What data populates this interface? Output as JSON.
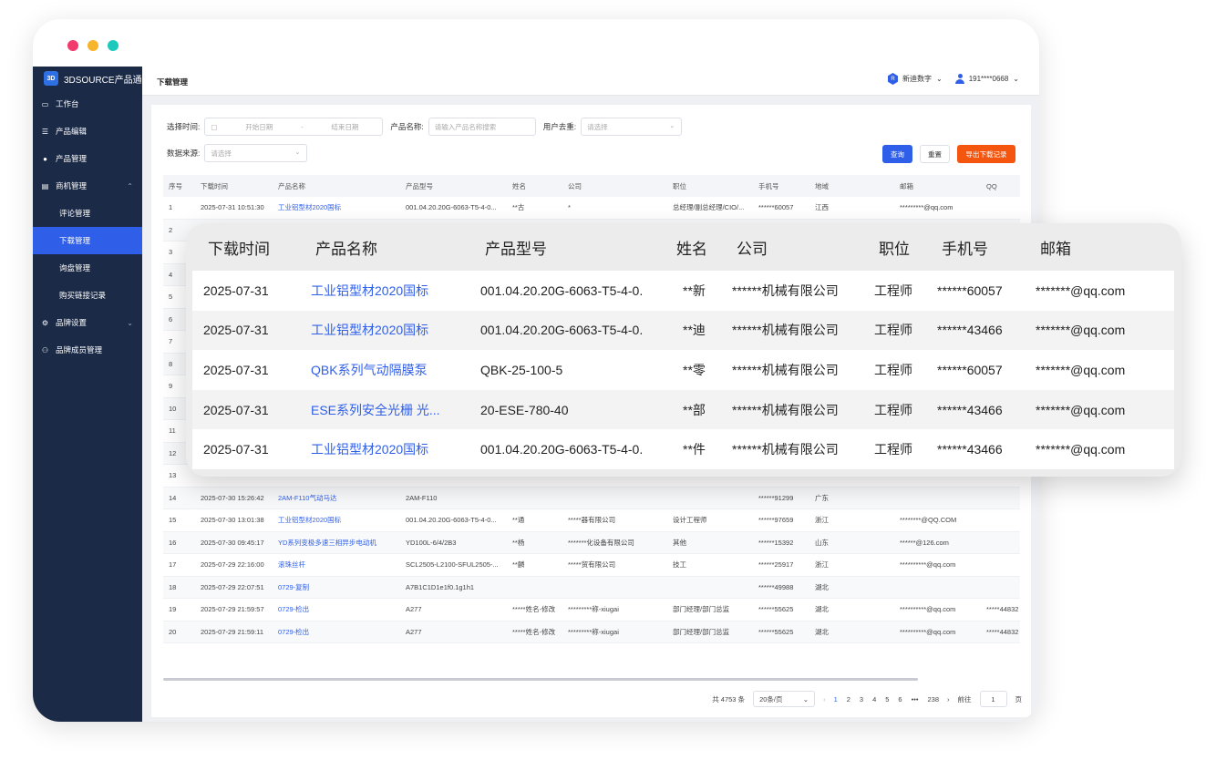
{
  "window": {
    "dot_colors": [
      "#f23a6d",
      "#f7b52c",
      "#1dc9bd"
    ]
  },
  "sidebar": {
    "logo_badge": "3D",
    "logo_text": "3DSOURCE产品通",
    "items": [
      {
        "label": "工作台",
        "icon": "monitor-icon"
      },
      {
        "label": "产品编辑",
        "icon": "list-icon"
      },
      {
        "label": "产品管理",
        "icon": "user-icon"
      },
      {
        "label": "商机管理",
        "icon": "document-icon"
      },
      {
        "label": "评论管理"
      },
      {
        "label": "下载管理"
      },
      {
        "label": "询盘管理"
      },
      {
        "label": "购买链接记录"
      },
      {
        "label": "品牌设置",
        "icon": "gear-icon"
      },
      {
        "label": "品牌成员管理",
        "icon": "group-icon"
      }
    ]
  },
  "topbar": {
    "title": "下载管理",
    "brand": "新迪数字",
    "user": "191****0668"
  },
  "filters": {
    "time_label": "选择时间:",
    "start_placeholder": "开始日期",
    "range_sep": "-",
    "end_placeholder": "结束日期",
    "product_label": "产品名称:",
    "product_placeholder": "请输入产品名称搜索",
    "dedupe_label": "用户去重:",
    "dedupe_placeholder": "请选择",
    "source_label": "数据来源:",
    "source_placeholder": "请选择"
  },
  "buttons": {
    "query": "查询",
    "reset": "重置",
    "export": "导出下载记录"
  },
  "table": {
    "headers": [
      "序号",
      "下载时间",
      "产品名称",
      "产品型号",
      "姓名",
      "公司",
      "职位",
      "手机号",
      "地域",
      "邮箱",
      "QQ"
    ],
    "rows": [
      [
        "1",
        "2025-07-31 10:51:30",
        "工业铝型材2020国标",
        "001.04.20.20G-6063-T5-4-0...",
        "**古",
        "*",
        "总经理/副总经理/CIO/...",
        "******60057",
        "江西",
        "*********@qq.com",
        ""
      ],
      [
        "2",
        "",
        "",
        "",
        "",
        "",
        "",
        "",
        "",
        "",
        ""
      ],
      [
        "3",
        "",
        "",
        "",
        "",
        "",
        "",
        "",
        "",
        "",
        ""
      ],
      [
        "4",
        "",
        "",
        "",
        "",
        "",
        "",
        "",
        "",
        "",
        ""
      ],
      [
        "5",
        "",
        "",
        "",
        "",
        "",
        "",
        "",
        "",
        "",
        ""
      ],
      [
        "6",
        "",
        "",
        "",
        "",
        "",
        "",
        "",
        "",
        "",
        ""
      ],
      [
        "7",
        "",
        "",
        "",
        "",
        "",
        "",
        "",
        "",
        "",
        ""
      ],
      [
        "8",
        "",
        "",
        "",
        "",
        "",
        "",
        "",
        "",
        "",
        ""
      ],
      [
        "9",
        "",
        "",
        "",
        "",
        "",
        "",
        "",
        "",
        "",
        ""
      ],
      [
        "10",
        "",
        "",
        "",
        "",
        "",
        "",
        "",
        "",
        "",
        ""
      ],
      [
        "11",
        "",
        "",
        "",
        "",
        "",
        "",
        "",
        "",
        "",
        ""
      ],
      [
        "12",
        "",
        "",
        "",
        "",
        "",
        "",
        "",
        "",
        "",
        ""
      ],
      [
        "13",
        "",
        "",
        "",
        "",
        "",
        "",
        "",
        "",
        "",
        ""
      ],
      [
        "14",
        "2025-07-30 15:26:42",
        "2AM-F110气动马达",
        "2AM-F110",
        "",
        "",
        "",
        "******91299",
        "广东",
        "",
        ""
      ],
      [
        "15",
        "2025-07-30 13:01:38",
        "工业铝型材2020国标",
        "001.04.20.20G-6063-T5-4-0...",
        "**通",
        "*****器有限公司",
        "设计工程师",
        "******97659",
        "浙江",
        "********@QQ.COM",
        ""
      ],
      [
        "16",
        "2025-07-30 09:45:17",
        "YD系列变极多速三相异步电动机",
        "YD100L-6/4/2B3",
        "**杨",
        "*******化设备有限公司",
        "其他",
        "******15392",
        "山东",
        "******@126.com",
        ""
      ],
      [
        "17",
        "2025-07-29 22:16:00",
        "滚珠丝杆",
        "SCL2505-L2100-SFUL2505-...",
        "**麟",
        "*****贸有限公司",
        "技工",
        "******25917",
        "浙江",
        "**********@qq.com",
        ""
      ],
      [
        "18",
        "2025-07-29 22:07:51",
        "0729-复制",
        "A7B1C1D1e1f0.1g1h1",
        "",
        "",
        "",
        "******49988",
        "湖北",
        "",
        ""
      ],
      [
        "19",
        "2025-07-29 21:59:57",
        "0729-检出",
        "A277",
        "*****姓名-修改",
        "*********称-xiugai",
        "部门经理/部门总监",
        "******55625",
        "湖北",
        "**********@qq.com",
        "*****44832"
      ],
      [
        "20",
        "2025-07-29 21:59:11",
        "0729-检出",
        "A277",
        "*****姓名-修改",
        "*********称-xiugai",
        "部门经理/部门总监",
        "******55625",
        "湖北",
        "**********@qq.com",
        "*****44832"
      ]
    ]
  },
  "pagination": {
    "total": "共 4753 条",
    "page_size": "20条/页",
    "prev": "‹",
    "pages": [
      "1",
      "2",
      "3",
      "4",
      "5",
      "6",
      "•••",
      "238"
    ],
    "next": "›",
    "goto_label": "前往",
    "goto_value": "1",
    "page_suffix": "页"
  },
  "overlay": {
    "headers": [
      "下载时间",
      "产品名称",
      "产品型号",
      "姓名",
      "公司",
      "职位",
      "手机号",
      "邮箱"
    ],
    "rows": [
      [
        "2025-07-31",
        "工业铝型材2020国标",
        "001.04.20.20G-6063-T5-4-0.",
        "**新",
        "******机械有限公司",
        "工程师",
        "******60057",
        "*******@qq.com"
      ],
      [
        "2025-07-31",
        "工业铝型材2020国标",
        "001.04.20.20G-6063-T5-4-0.",
        "**迪",
        "******机械有限公司",
        "工程师",
        "******43466",
        "*******@qq.com"
      ],
      [
        "2025-07-31",
        "QBK系列气动隔膜泵",
        "QBK-25-100-5",
        "**零",
        "******机械有限公司",
        "工程师",
        "******60057",
        "*******@qq.com"
      ],
      [
        "2025-07-31",
        "ESE系列安全光栅 光...",
        "20-ESE-780-40",
        "**部",
        "******机械有限公司",
        "工程师",
        "******43466",
        "*******@qq.com"
      ],
      [
        "2025-07-31",
        "工业铝型材2020国标",
        "001.04.20.20G-6063-T5-4-0.",
        "**件",
        "******机械有限公司",
        "工程师",
        "******43466",
        "*******@qq.com"
      ]
    ]
  }
}
